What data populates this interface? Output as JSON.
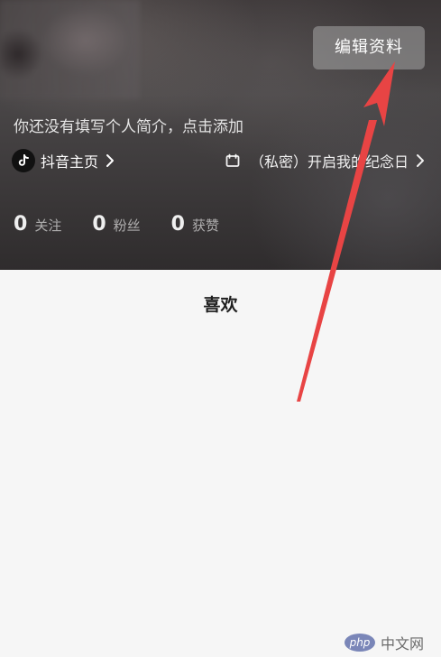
{
  "profile": {
    "edit_button_label": "编辑资料",
    "bio_placeholder": "你还没有填写个人简介，点击添加",
    "links": {
      "douyin_home_label": "抖音主页",
      "anniversary_label": "（私密）开启我的纪念日"
    },
    "stats": [
      {
        "value": "0",
        "label": "关注"
      },
      {
        "value": "0",
        "label": "粉丝"
      },
      {
        "value": "0",
        "label": "获赞"
      }
    ]
  },
  "tabs": {
    "active_label": "喜欢"
  },
  "watermark": {
    "logo_text": "php",
    "site_text": "中文网"
  },
  "annotation": {
    "arrow_color": "#e84444"
  },
  "icons": {
    "douyin_logo": "douyin-logo-icon",
    "chevron": "chevron-right-icon",
    "calendar": "calendar-icon"
  }
}
